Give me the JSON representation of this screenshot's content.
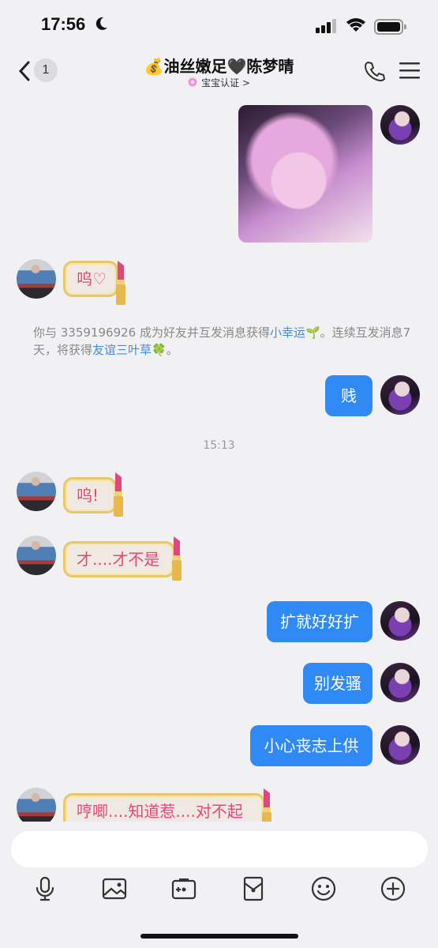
{
  "status_bar": {
    "time": "17:56"
  },
  "header": {
    "badge_count": "1",
    "title": "💰油丝嫩足🖤陈梦晴",
    "subtitle": "宝宝认证 >"
  },
  "messages": {
    "m1_her": "呜♡",
    "system_notice": {
      "prefix": "你与 3359196926 成为好友并互发消息获得",
      "link1": "小幸运🌱",
      "middle": "。连续互发消息7天，将获得",
      "link2": "友谊三叶草🍀",
      "suffix": "。"
    },
    "m2_me": "贱",
    "timestamp": "15:13",
    "m3_her": "呜!",
    "m4_her": "才....才不是",
    "m5_me": "扩就好好扩",
    "m6_me": "别发骚",
    "m7_me": "小心丧志上供",
    "m8_her": "哼唧....知道惹....对不起"
  },
  "toolbar": {
    "icons": [
      "microphone-icon",
      "image-icon",
      "camera-icon",
      "red-packet-icon",
      "emoji-icon",
      "plus-icon"
    ]
  },
  "colors": {
    "accent": "#2f8af5",
    "her_text": "#e6457a",
    "link": "#3c8fe0"
  }
}
